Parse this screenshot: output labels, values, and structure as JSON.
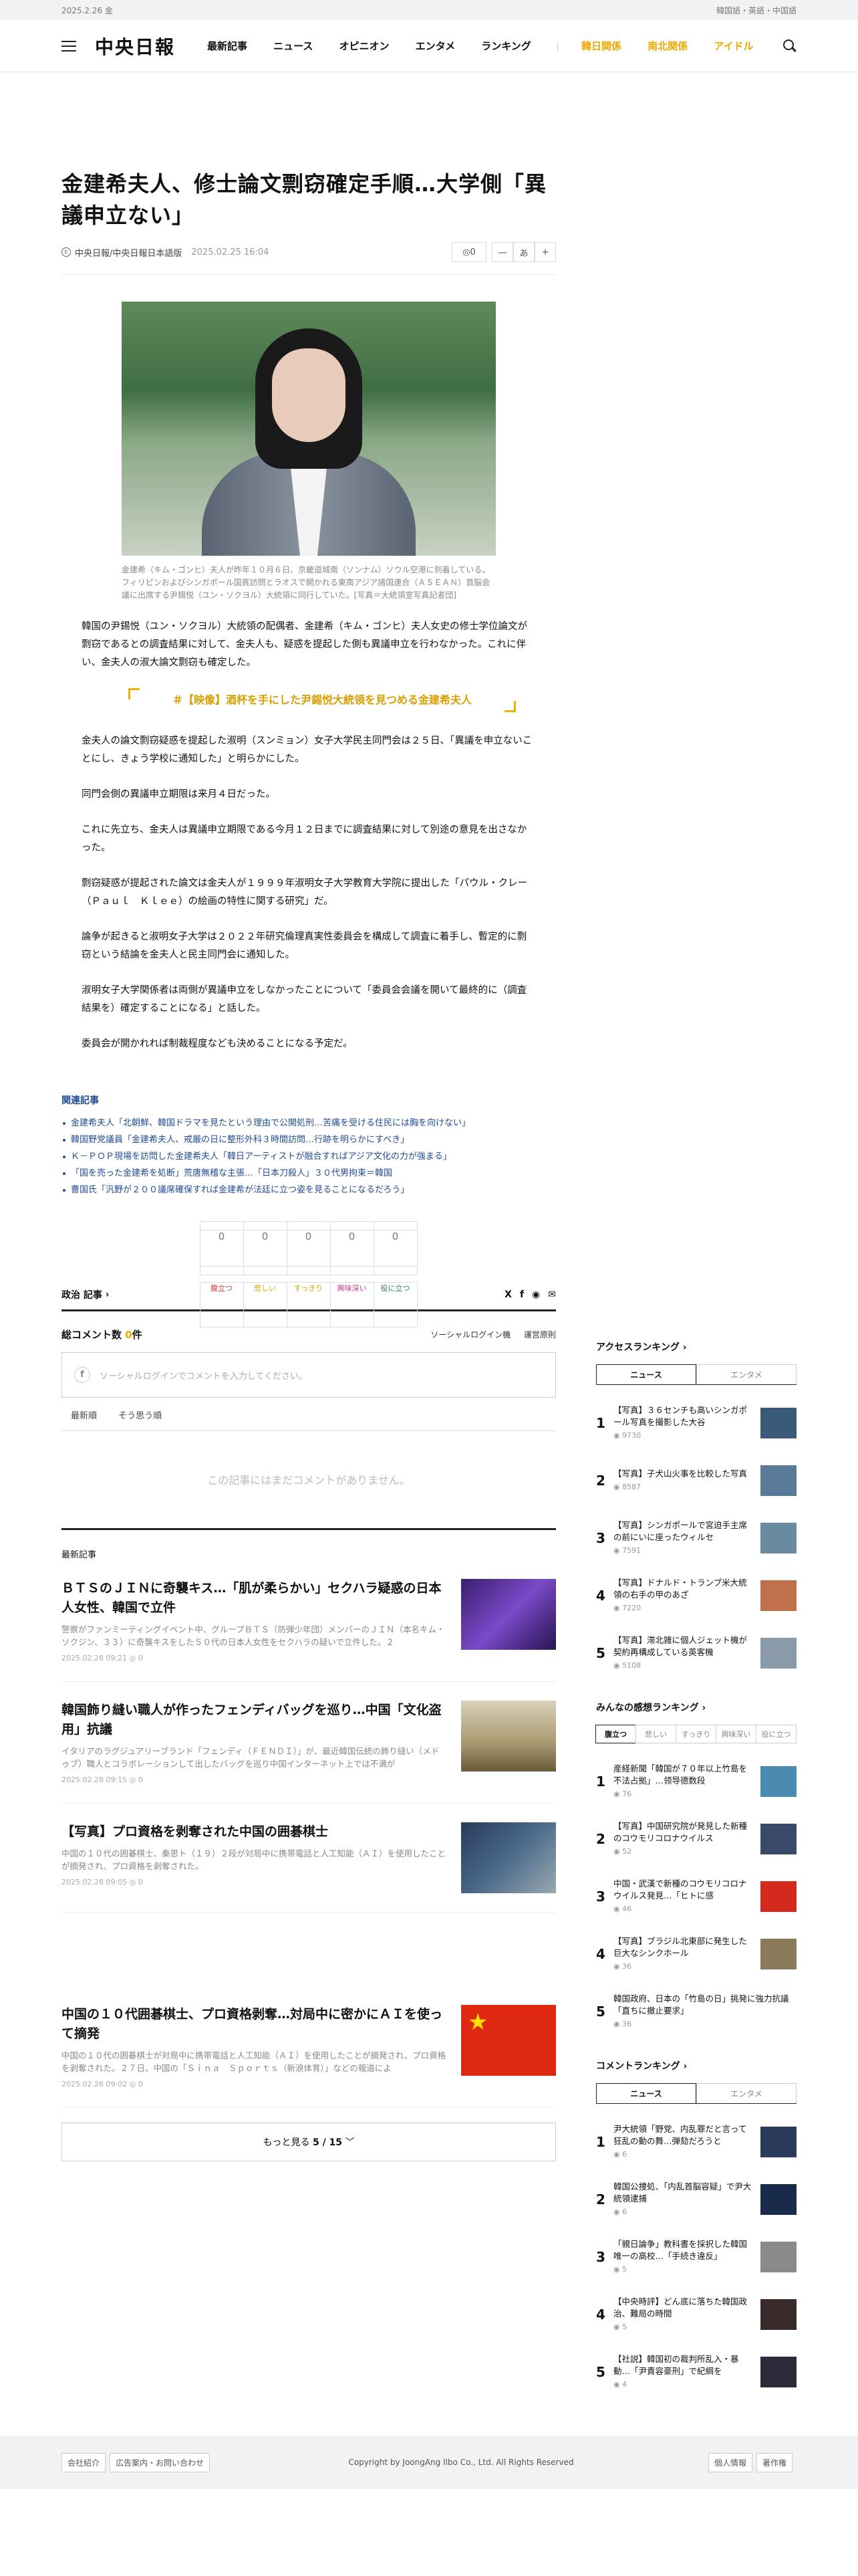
{
  "topstrip": {
    "date": "2025.2.26 金",
    "langs": "韓国語・英語・中国語"
  },
  "header": {
    "logo": "中央日報",
    "nav": [
      "最新記事",
      "ニュース",
      "オピニオン",
      "エンタメ",
      "ランキング"
    ],
    "special": [
      "韓日関係",
      "南北関係",
      "アイドル"
    ]
  },
  "article": {
    "title": "金建希夫人、修士論文剽窃確定手順…大学側「異議申立ない」",
    "source": "中央日報/中央日報日本語版",
    "date": "2025.02.25 16:04",
    "comment_count": "0",
    "font_tools": [
      "一",
      "あ",
      "+"
    ],
    "caption": "金建希（キム・ゴンヒ）夫人が昨年１０月６日、京畿道城南（ソンナム）ソウル空港に到着している。フィリピンおよびシンガポール国賓訪問とラオスで開かれる東南アジア諸国連合（ＡＳＥＡＮ）首脳会議に出席する尹錫悦（ユン・ソクヨル）大統領に同行していた。[写真＝大統領室写真記者団]",
    "lead": "韓国の尹錫悦（ユン・ソクヨル）大統領の配偶者、金建希（キム・ゴンヒ）夫人女史の修士学位論文が剽窃であるとの調査結果に対して、金夫人も、疑惑を提起した側も異議申立を行わなかった。これに伴い、金夫人の淑大論文剽窃も確定した。",
    "promo": "＃【映像】酒杯を手にした尹錫悦大統領を見つめる金建希夫人",
    "paragraphs": [
      "金夫人の論文剽窃疑惑を提起した淑明（スンミョン）女子大学民主同門会は２５日、「異議を申立ないことにし、きょう学校に通知した」と明らかにした。",
      "同門会側の異議申立期限は来月４日だった。",
      "これに先立ち、金夫人は異議申立期限である今月１２日までに調査結果に対して別途の意見を出さなかった。",
      "剽窃疑惑が提起された論文は金夫人が１９９９年淑明女子大学教育大学院に提出した「パウル・クレー（Ｐａｕｌ　Ｋｌｅｅ）の絵画の特性に関する研究」だ。",
      "論争が起きると淑明女子大学は２０２２年研究倫理真実性委員会を構成して調査に着手し、暫定的に剽窃という結論を金夫人と民主同門会に通知した。",
      "淑明女子大学関係者は両側が異議申立をしなかったことについて「委員会会議を開いて最終的に（調査結果を）確定することになる」と話した。",
      "委員会が開かれれば制裁程度なども決めることになる予定だ。"
    ]
  },
  "related": {
    "heading": "関連記事",
    "items": [
      "金建希夫人「北朝鮮、韓国ドラマを見たという理由で公開処刑…苦痛を受ける住民には胸を向けない」",
      "韓国野党議員「金建希夫人、戒厳の日に整形外科３時間訪問…行跡を明らかにすべき」",
      "Ｋ－ＰＯＰ現場を訪問した金建希夫人「韓日アーティストが融合すればアジア文化の力が強まる」",
      "「国を売った金建希を処断」荒唐無稽な主張…「日本刀殺人」３０代男拘束＝韓国",
      "曹国氏「汎野が２００議席確保すれば金建希が法廷に立つ姿を見ることになるだろう」"
    ]
  },
  "reactions": [
    {
      "n": "0",
      "label": "腹立つ",
      "color": "#d23c3c"
    },
    {
      "n": "0",
      "label": "悲しい",
      "color": "#e0a100"
    },
    {
      "n": "0",
      "label": "すっきり",
      "color": "#d4a400"
    },
    {
      "n": "0",
      "label": "興味深い",
      "color": "#c23c8a"
    },
    {
      "n": "0",
      "label": "役に立つ",
      "color": "#2a8a4a"
    }
  ],
  "section": {
    "label": "政治 記事"
  },
  "comments": {
    "label": "総コメント数",
    "count": "0",
    "unit": "件",
    "social_login": "ソーシャルログイン機",
    "policy": "運営原則",
    "placeholder": "ソーシャルログインでコメントを入力してください。",
    "sort_new": "最新順",
    "sort_like": "そう思う順",
    "empty": "この記事にはまだコメントがありません。"
  },
  "latest": {
    "heading": "最新記事",
    "items": [
      {
        "title": "ＢＴＳのＪＩＮに奇襲キス…「肌が柔らかい」セクハラ疑惑の日本人女性、韓国で立件",
        "desc": "警察がファンミーティングイベント中、グループＢＴＳ（防弾少年団）メンバーのＪＩＮ（本名キム・ソクジン、３３）に奇襲キスをした５０代の日本人女性をセクハラの疑いで立件した。２",
        "date": "2025.02.28 09:21",
        "cmt": "0",
        "img": "purple"
      },
      {
        "title": "韓国飾り縫い職人が作ったフェンディバッグを巡り…中国「文化盗用」抗議",
        "desc": "イタリアのラグジュアリーブランド「フェンディ（ＦＥＮＤＩ）」が、最近韓国伝統の飾り縫い（メドゥブ）職人とコラボレーションして出したバッグを巡り中国インターネット上では不満が",
        "date": "2025.02.28 09:15",
        "cmt": "0",
        "img": "bag"
      },
      {
        "title": "【写真】プロ資格を剥奪された中国の囲碁棋士",
        "desc": "中国の１０代の囲碁棋士、秦思ト（１９）２段が対局中に携帯電話と人工知能（ＡＩ）を使用したことが摘発され、プロ資格を剥奪された。",
        "date": "2025.02.28 09:05",
        "cmt": "0",
        "img": "go"
      },
      {
        "title": "中国の１０代囲碁棋士、プロ資格剥奪…対局中に密かにＡＩを使って摘発",
        "desc": "中国の１０代の囲碁棋士が対局中に携帯電話と人工知能（ＡＩ）を使用したことが摘発され、プロ資格を剥奪された。２７日、中国の「Ｓｉｎａ　Ｓｐｏｒｔｓ（新浪体育）」などの報道によ",
        "date": "2025.02.28 09:02",
        "cmt": "0",
        "img": "flag"
      }
    ],
    "more": "もっと見る",
    "page": "5 / 15"
  },
  "side": {
    "access": {
      "heading": "アクセスランキング",
      "tabs": [
        "ニュース",
        "エンタメ"
      ],
      "items": [
        {
          "t": "【写真】３６センチも高いシンガポール写真を撮影した大谷",
          "v": "9730",
          "img": "#3a5a7a"
        },
        {
          "t": "【写真】子犬山火事を比較した写真",
          "v": "8587",
          "img": "#5a7a9a"
        },
        {
          "t": "【写真】シンガポールで宮迫手主席の前にいに座ったウィルセ",
          "v": "7591",
          "img": "#6a8aa0"
        },
        {
          "t": "【写真】ドナルド・トランプ米大統領の右手の甲のあざ",
          "v": "7220",
          "img": "#c0704a"
        },
        {
          "t": "【写真】滞北雑に個人ジェット機が契約再構成している英客機",
          "v": "5108",
          "img": "#8a9aa8"
        }
      ]
    },
    "reaction": {
      "heading": "みんなの感想ランキング",
      "tabs": [
        "腹立つ",
        "悲しい",
        "すっきり",
        "興味深い",
        "役に立つ"
      ],
      "items": [
        {
          "t": "産経新聞「韓国が７０年以上竹島を不法占拠」…领导德数段",
          "v": "76",
          "img": "#4a8ab0"
        },
        {
          "t": "【写真】中国研究院が発見した新種のコウモリコロナウイルス",
          "v": "52",
          "img": "#3a4a6a"
        },
        {
          "t": "中国・武漢で新種のコウモリコロナウイルス発見…「ヒトに感",
          "v": "46",
          "img": "#d42a1e"
        },
        {
          "t": "【写真】ブラジル北東部に発生した巨大なシンクホール",
          "v": "36",
          "img": "#8a7a5a"
        },
        {
          "t": "韓国政府、日本の「竹島の日」挑発に強力抗議「直ちに撤止要求」",
          "v": "36",
          "img": ""
        }
      ]
    },
    "comment": {
      "heading": "コメントランキング",
      "tabs": [
        "ニュース",
        "エンタメ"
      ],
      "items": [
        {
          "t": "尹大統領「野党、内乱罪だと言って狂乱の動の舞…弾劾だろうと",
          "v": "6",
          "img": "#2a3a5a"
        },
        {
          "t": "韓国公捜処、「内乱首脳容疑」で尹大統領逮捕",
          "v": "6",
          "img": "#1a2a4a"
        },
        {
          "t": "「親日論争」教科書を採択した韓国唯一の高校…「手続き違反」",
          "v": "5",
          "img": "#8a8a8a"
        },
        {
          "t": "【中央時評】どん底に落ちた韓国政治、難局の時間",
          "v": "5",
          "img": "#3a2a2a"
        },
        {
          "t": "【社説】韓国初の裁判所乱入・暴動…「尹責容豪刑」で紀綱を",
          "v": "4",
          "img": "#2a2a3a"
        }
      ]
    }
  },
  "footer": {
    "links_left": [
      "会社紹介",
      "広告案内・お問い合わせ"
    ],
    "copyright": "Copyright by JoongAng Ilbo Co., Ltd. All Rights Reserved",
    "links_right": [
      "個人情報",
      "著作権"
    ]
  }
}
